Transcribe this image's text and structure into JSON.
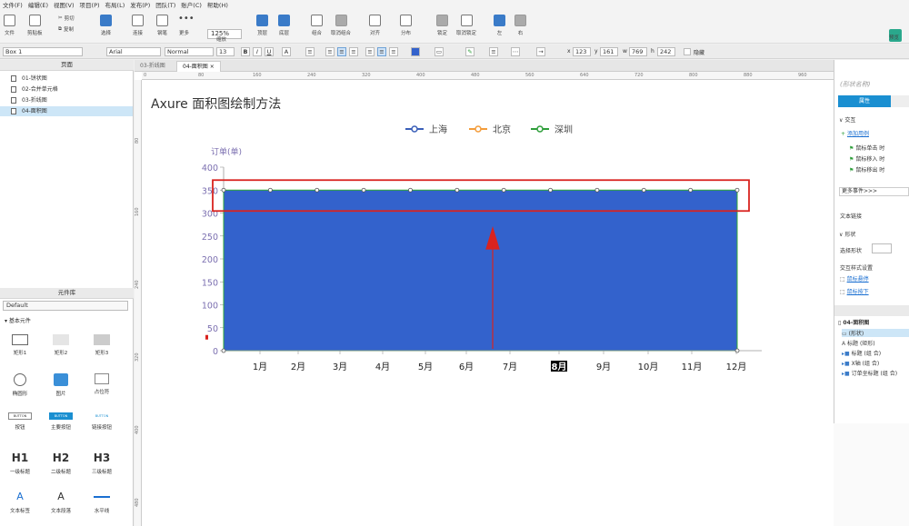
{
  "menu": [
    "文件(F)",
    "编辑(E)",
    "视图(V)",
    "项目(P)",
    "布局(L)",
    "发布(P)",
    "团队(T)",
    "账户(C)",
    "帮助(H)"
  ],
  "toolbar": {
    "file_label": "文件",
    "clipboard_label": "剪贴板",
    "cut_label": "剪切",
    "copy_label": "复制",
    "select_label": "选择",
    "connect_label": "连接",
    "pen_label": "钢笔",
    "more_label": "更多",
    "zoom_value": "125%",
    "zoom_label": "缩放",
    "top_label": "顶层",
    "bottom_label": "底层",
    "group_label": "组合",
    "ungroup_label": "取消组合",
    "align_label": "对齐",
    "distribute_label": "分布",
    "lock_label": "锁定",
    "unlock_label": "取消锁定",
    "left_label": "左",
    "right_label": "右",
    "preview_label": "预览"
  },
  "format": {
    "element_name": "Box 1",
    "font": "Arial",
    "weight": "Normal",
    "size": "13",
    "x_label": "x",
    "x": "123",
    "y_label": "y",
    "y": "161",
    "w_label": "w",
    "w": "769",
    "h_label": "h",
    "h": "242",
    "hidden_label": "隐藏"
  },
  "pages_panel": {
    "title": "页面",
    "pages": [
      "01-饼状图",
      "02-合并单元格",
      "03-折线图",
      "04-面积图"
    ]
  },
  "library_panel": {
    "title": "元件库",
    "library": "Default",
    "section": "基本元件",
    "widgets": [
      "矩形1",
      "矩形2",
      "矩形3",
      "椭圆形",
      "图片",
      "占位符",
      "按钮",
      "主要按钮",
      "链接按钮",
      "一级标题",
      "二级标题",
      "三级标题",
      "文本标签",
      "文本段落",
      "水平线"
    ],
    "button_text": "BUTTON",
    "h1": "H1",
    "h2": "H2",
    "h3": "H3",
    "text_glyph": "A"
  },
  "tabs": [
    "03-折线图",
    "04-面积图"
  ],
  "ruler_h": [
    "0",
    "80",
    "160",
    "240",
    "320",
    "400",
    "480",
    "560",
    "640",
    "720",
    "800",
    "880",
    "960"
  ],
  "ruler_v": [
    "80",
    "160",
    "240",
    "320",
    "400",
    "480"
  ],
  "canvas": {
    "title": "Axure 面积图绘制方法"
  },
  "colors": {
    "area": "#3362cc",
    "area_border": "#33aa33",
    "shanghai": "#3a5fb8",
    "beijing": "#f39c3a",
    "shenzhen": "#2e9e3a",
    "highlight": "#d9231f",
    "axis_text": "#7b6fb0",
    "accent": "#1a8fd1"
  },
  "chart_data": {
    "type": "area",
    "ylabel": "订单(单)",
    "categories": [
      "1月",
      "2月",
      "3月",
      "4月",
      "5月",
      "6月",
      "7月",
      "8月",
      "9月",
      "10月",
      "11月",
      "12月"
    ],
    "ylim": [
      0,
      400
    ],
    "yticks": [
      0,
      50,
      100,
      150,
      200,
      250,
      300,
      350,
      400
    ],
    "legend": [
      "上海",
      "北京",
      "深圳"
    ],
    "legend_position": "top-center",
    "series": [
      {
        "name": "上海",
        "values": [
          350,
          350,
          350,
          350,
          350,
          350,
          350,
          350,
          350,
          350,
          350,
          350
        ]
      }
    ],
    "selected_category": "8月"
  },
  "right_panel": {
    "shape_name_placeholder": "(形状名称)",
    "tab_properties": "属性",
    "interaction": "交互",
    "add_case": "添加用例",
    "events": [
      "鼠标单击 时",
      "鼠标移入 时",
      "鼠标移出 时"
    ],
    "more_events": "更多事件>>>",
    "text_link": "文本链接",
    "shape": "形状",
    "select_shape": "选择形状",
    "interaction_style": "交互样式设置",
    "mouse_hover": "鼠标悬停",
    "mouse_down": "鼠标按下"
  },
  "outline": {
    "page": "04-面积图",
    "items": [
      "(形状)",
      "标题 (矩形)",
      "标题 (组 合)",
      "X轴 (组 合)",
      "订单坐标题 (组 合)"
    ]
  }
}
